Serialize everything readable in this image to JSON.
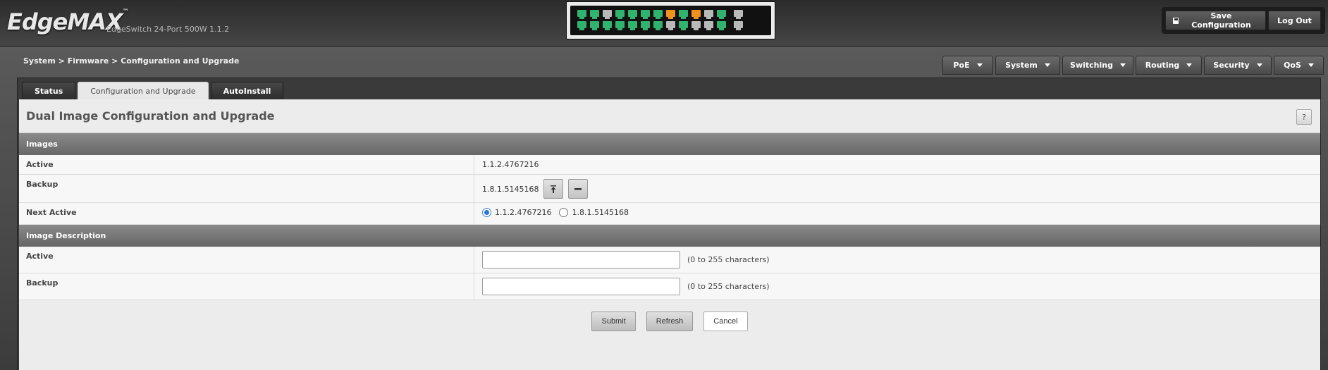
{
  "app": {
    "brand": "EdgeMAX",
    "brand_tm": "™",
    "model": "EdgeSwitch 24-Port 500W 1.1.2"
  },
  "header": {
    "save_label": "Save Configuration",
    "save_icon": "floppy-disk-icon",
    "logout_label": "Log Out"
  },
  "ports": {
    "top_row": [
      "green",
      "green",
      "gray",
      "green",
      "green",
      "green",
      "green",
      "orange",
      "green",
      "orange",
      "gray",
      "green",
      "gray"
    ],
    "bottom_row": [
      "green",
      "green",
      "green",
      "green",
      "green",
      "green",
      "green",
      "gray",
      "green",
      "gray",
      "gray",
      "green",
      "gray"
    ],
    "colors": {
      "green": "#2fb36f",
      "orange": "#f0901e",
      "gray": "#b9b9b9"
    }
  },
  "breadcrumb": "System > Firmware > Configuration and Upgrade",
  "menu": {
    "items": [
      {
        "label": "PoE"
      },
      {
        "label": "System"
      },
      {
        "label": "Switching"
      },
      {
        "label": "Routing"
      },
      {
        "label": "Security"
      },
      {
        "label": "QoS"
      }
    ]
  },
  "tabs": [
    {
      "label": "Status",
      "active": false
    },
    {
      "label": "Configuration and Upgrade",
      "active": true
    },
    {
      "label": "AutoInstall",
      "active": false
    }
  ],
  "page": {
    "title": "Dual Image Configuration and Upgrade",
    "help_label": "?"
  },
  "images": {
    "heading": "Images",
    "active_label": "Active",
    "active_value": "1.1.2.4767216",
    "backup_label": "Backup",
    "backup_value": "1.8.1.5145168",
    "activate_icon": "upload-icon",
    "delete_icon": "minus-icon",
    "next_active_label": "Next Active",
    "next_active_options": [
      "1.1.2.4767216",
      "1.8.1.5145168"
    ],
    "next_active_selected": "1.1.2.4767216"
  },
  "description": {
    "heading": "Image Description",
    "active_label": "Active",
    "active_value": "",
    "active_hint": "(0 to 255 characters)",
    "backup_label": "Backup",
    "backup_value": "",
    "backup_hint": "(0 to 255 characters)"
  },
  "actions": {
    "submit": "Submit",
    "refresh": "Refresh",
    "cancel": "Cancel"
  },
  "colors": {
    "accent_radio": "#2b73d6"
  }
}
